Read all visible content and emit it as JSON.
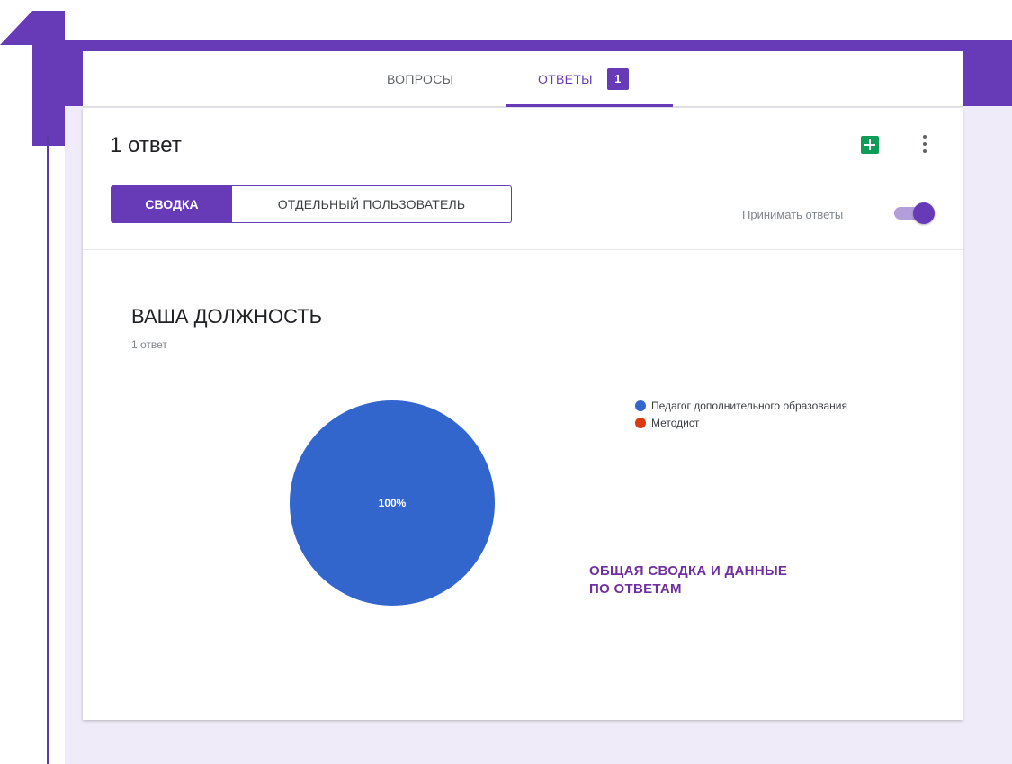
{
  "tabs": {
    "questions_label": "ВОПРОСЫ",
    "responses_label": "ОТВЕТЫ",
    "responses_count": "1"
  },
  "header": {
    "response_count": "1 ответ",
    "summary_label": "СВОДКА",
    "individual_label": "ОТДЕЛЬНЫЙ ПОЛЬЗОВАТЕЛЬ",
    "accept_responses_label": "Принимать ответы",
    "accept_responses_on": true
  },
  "question": {
    "title": "ВАША ДОЛЖНОСТЬ",
    "response_count": "1 ответ"
  },
  "chart_data": {
    "type": "pie",
    "categories": [
      "Педагог дополнительного образования",
      "Методист"
    ],
    "values": [
      100,
      0
    ],
    "colors": [
      "#3366cc",
      "#dc3912"
    ],
    "data_labels": [
      "100%"
    ],
    "legend_position": "right"
  },
  "annotation": {
    "line1": "ОБЩАЯ СВОДКА И ДАННЫЕ",
    "line2": "ПО ОТВЕТАМ"
  },
  "colors": {
    "brand_purple": "#673ab7",
    "background_lavender": "#efebf8",
    "sheets_green": "#0f9d58",
    "annotation_purple": "#7030a0"
  },
  "icons": [
    "sheets-icon",
    "more-vert-icon"
  ]
}
